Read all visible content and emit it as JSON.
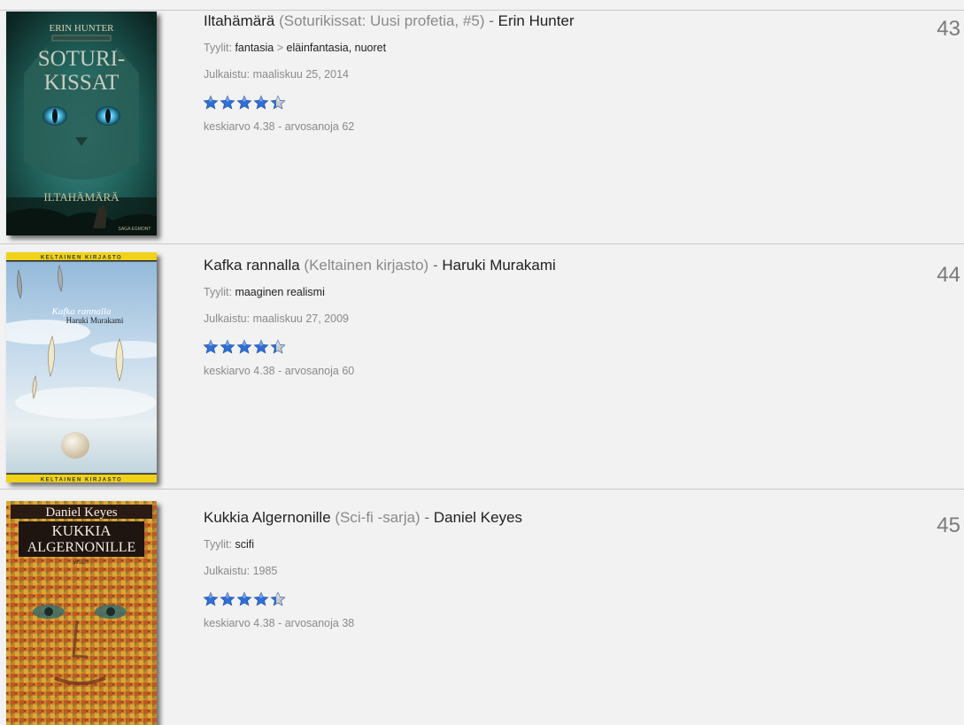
{
  "books": [
    {
      "title": "Iltahämärä",
      "series": "(Soturikissat: Uusi profetia, #5)",
      "separator": "-",
      "author": "Erin Hunter",
      "genres_label": "Tyylit:",
      "genre_main": "fantasia",
      "genre_sep": ">",
      "genre_sub": "eläinfantasia, nuoret",
      "published": "Julkaistu: maaliskuu 25, 2014",
      "rating_value": 4.38,
      "stats": "keskiarvo 4.38 - arvosanoja 62",
      "rank": "43",
      "cover": {
        "author_text": "ERIN HUNTER",
        "series_text_1": "SOTURI-",
        "series_text_2": "KISSAT",
        "title_text": "ILTAHÄMÄRÄ",
        "publisher_text": "SAGA EGMONT"
      }
    },
    {
      "title": "Kafka rannalla",
      "series": "(Keltainen kirjasto)",
      "separator": "-",
      "author": "Haruki Murakami",
      "genres_label": "Tyylit:",
      "genre_main": "maaginen realismi",
      "published": "Julkaistu: maaliskuu 27, 2009",
      "rating_value": 4.38,
      "stats": "keskiarvo 4.38 - arvosanoja 60",
      "rank": "44",
      "cover": {
        "band_text": "KELTAINEN KIRJASTO",
        "title_text": "Kafka rannalla",
        "author_text": "Haruki Murakami"
      }
    },
    {
      "title": "Kukkia Algernonille",
      "series": "(Sci-fi -sarja)",
      "separator": "-",
      "author": "Daniel Keyes",
      "genres_label": "Tyylit:",
      "genre_main": "scifi",
      "published": "Julkaistu: 1985",
      "rating_value": 4.38,
      "stats": "keskiarvo 4.38 - arvosanoja 38",
      "rank": "45",
      "cover": {
        "author_text": "Daniel Keyes",
        "title_text_1": "KUKKIA",
        "title_text_2": "ALGERNONILLE",
        "publisher_text": "WSOY"
      }
    }
  ],
  "colors": {
    "star_fill": "#2f6fd6",
    "star_empty": "#c9c9c9",
    "rank": "#7a7a7a",
    "background": "#f2f2f2"
  }
}
